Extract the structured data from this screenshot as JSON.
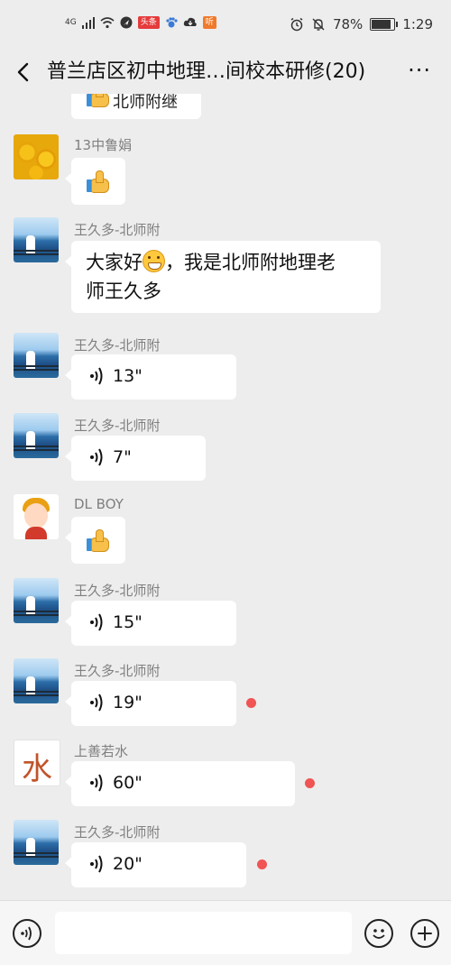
{
  "status_bar": {
    "network": "4G",
    "badge_toutiao": "头条",
    "badge_ting": "听",
    "battery": "78%",
    "time": "1:29"
  },
  "header": {
    "title": "普兰店区初中地理…间校本研修(20)",
    "more": "···"
  },
  "messages": [
    {
      "sender": "",
      "type": "text",
      "content": "北师附继续",
      "partial": true
    },
    {
      "sender": "13中鲁娟",
      "type": "emoji",
      "content": "thumbs-up"
    },
    {
      "sender": "王久多-北师附",
      "type": "text",
      "content_before": "大家好",
      "content_after": "，我是北师附地理老",
      "content_line2": "师王久多"
    },
    {
      "sender": "王久多-北师附",
      "type": "voice",
      "duration": "13\""
    },
    {
      "sender": "王久多-北师附",
      "type": "voice",
      "duration": "7\""
    },
    {
      "sender": "DL BOY",
      "type": "emoji",
      "content": "thumbs-up"
    },
    {
      "sender": "王久多-北师附",
      "type": "voice",
      "duration": "15\""
    },
    {
      "sender": "王久多-北师附",
      "type": "voice",
      "duration": "19\"",
      "unread": true
    },
    {
      "sender": "上善若水",
      "type": "voice",
      "duration": "60\"",
      "unread": true
    },
    {
      "sender": "王久多-北师附",
      "type": "voice",
      "duration": "20\"",
      "unread": true
    }
  ],
  "avatars": {
    "water_glyph": "水"
  },
  "input_bar": {
    "placeholder": ""
  },
  "colors": {
    "background": "#ededed",
    "bubble": "#ffffff",
    "unread_dot": "#f05454",
    "sender_text": "#7f7f7f"
  }
}
